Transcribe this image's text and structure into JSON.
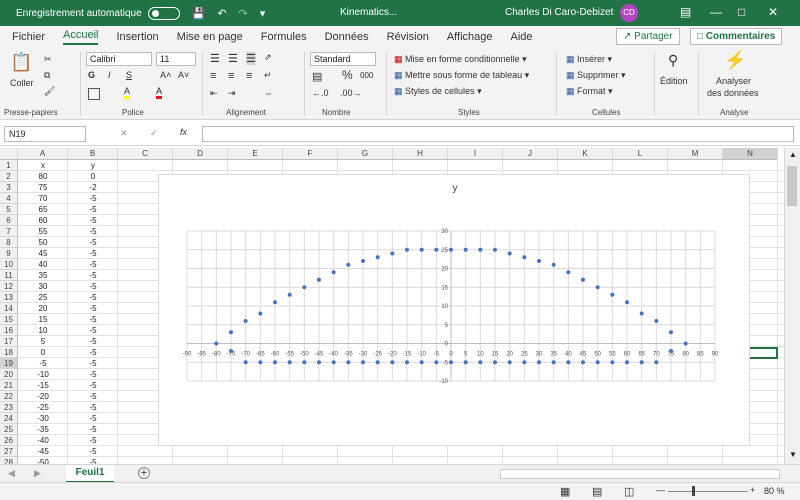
{
  "titlebar": {
    "autosave": "Enregistrement automatique",
    "title": "Kinematics...",
    "user": "Charles Di Caro-Debizet",
    "initials": "CD"
  },
  "tabs": [
    "Fichier",
    "Accueil",
    "Insertion",
    "Mise en page",
    "Formules",
    "Données",
    "Révision",
    "Affichage",
    "Aide"
  ],
  "share_label": "Partager",
  "comments_label": "Commentaires",
  "ribbon": {
    "paste": "Coller",
    "font_name": "Calibri",
    "font_size": "11",
    "number_format": "Standard",
    "cond_format": "Mise en forme conditionnelle",
    "table_format": "Mettre sous forme de tableau",
    "cell_styles": "Styles de cellules",
    "insert": "Insérer",
    "delete": "Supprimer",
    "format": "Format",
    "edit": "Édition",
    "analyze1": "Analyser",
    "analyze2": "des données",
    "groups": [
      "Presse-papiers",
      "Police",
      "Alignement",
      "Nombre",
      "Styles",
      "Cellules",
      "Analyse"
    ],
    "bold": "G",
    "italic": "I",
    "underline": "S",
    "percent": "%",
    "thousands": "000",
    "fill": "A",
    "fontcolor": "A"
  },
  "namebox": "N19",
  "fx": "fx",
  "columns": [
    "A",
    "B",
    "C",
    "D",
    "E",
    "F",
    "G",
    "H",
    "I",
    "J",
    "K",
    "L",
    "M",
    "N"
  ],
  "rows": [
    {
      "n": "1",
      "a": "x",
      "b": "y"
    },
    {
      "n": "2",
      "a": "80",
      "b": "0"
    },
    {
      "n": "3",
      "a": "75",
      "b": "-2"
    },
    {
      "n": "4",
      "a": "70",
      "b": "-5"
    },
    {
      "n": "5",
      "a": "65",
      "b": "-5"
    },
    {
      "n": "6",
      "a": "60",
      "b": "-5"
    },
    {
      "n": "7",
      "a": "55",
      "b": "-5"
    },
    {
      "n": "8",
      "a": "50",
      "b": "-5"
    },
    {
      "n": "9",
      "a": "45",
      "b": "-5"
    },
    {
      "n": "10",
      "a": "40",
      "b": "-5"
    },
    {
      "n": "11",
      "a": "35",
      "b": "-5"
    },
    {
      "n": "12",
      "a": "30",
      "b": "-5"
    },
    {
      "n": "13",
      "a": "25",
      "b": "-5"
    },
    {
      "n": "14",
      "a": "20",
      "b": "-5"
    },
    {
      "n": "15",
      "a": "15",
      "b": "-5"
    },
    {
      "n": "16",
      "a": "10",
      "b": "-5"
    },
    {
      "n": "17",
      "a": "5",
      "b": "-5"
    },
    {
      "n": "18",
      "a": "0",
      "b": "-5"
    },
    {
      "n": "19",
      "a": "-5",
      "b": "-5"
    },
    {
      "n": "20",
      "a": "-10",
      "b": "-5"
    },
    {
      "n": "21",
      "a": "-15",
      "b": "-5"
    },
    {
      "n": "22",
      "a": "-20",
      "b": "-5"
    },
    {
      "n": "23",
      "a": "-25",
      "b": "-5"
    },
    {
      "n": "24",
      "a": "-30",
      "b": "-5"
    },
    {
      "n": "25",
      "a": "-35",
      "b": "-5"
    },
    {
      "n": "26",
      "a": "-40",
      "b": "-5"
    },
    {
      "n": "27",
      "a": "-45",
      "b": "-5"
    },
    {
      "n": "28",
      "a": "-50",
      "b": "-5"
    }
  ],
  "sheet_tab": "Feuil1",
  "zoom": "80 %",
  "colors": {
    "accent": "#217346",
    "marker": "#4472c4"
  },
  "chart_data": {
    "type": "scatter",
    "title": "y",
    "xlim": [
      -90,
      90
    ],
    "ylim": [
      -10,
      30
    ],
    "xticks": [
      -90,
      -85,
      -80,
      -75,
      -70,
      -65,
      -60,
      -55,
      -50,
      -45,
      -40,
      -35,
      -30,
      -25,
      -20,
      -15,
      -10,
      -5,
      0,
      5,
      10,
      15,
      20,
      25,
      30,
      35,
      40,
      45,
      50,
      55,
      60,
      65,
      70,
      75,
      80,
      85,
      90
    ],
    "yticks": [
      -10,
      -5,
      0,
      5,
      10,
      15,
      20,
      25,
      30
    ],
    "grid": true,
    "points": [
      {
        "x": -80,
        "y": 0
      },
      {
        "x": -75,
        "y": 3
      },
      {
        "x": -70,
        "y": 6
      },
      {
        "x": -65,
        "y": 8
      },
      {
        "x": -60,
        "y": 11
      },
      {
        "x": -55,
        "y": 13
      },
      {
        "x": -50,
        "y": 15
      },
      {
        "x": -45,
        "y": 17
      },
      {
        "x": -40,
        "y": 19
      },
      {
        "x": -35,
        "y": 21
      },
      {
        "x": -30,
        "y": 22
      },
      {
        "x": -25,
        "y": 23
      },
      {
        "x": -20,
        "y": 24
      },
      {
        "x": -15,
        "y": 25
      },
      {
        "x": -10,
        "y": 25
      },
      {
        "x": -5,
        "y": 25
      },
      {
        "x": 0,
        "y": 25
      },
      {
        "x": 5,
        "y": 25
      },
      {
        "x": 10,
        "y": 25
      },
      {
        "x": 15,
        "y": 25
      },
      {
        "x": 20,
        "y": 24
      },
      {
        "x": 25,
        "y": 23
      },
      {
        "x": 30,
        "y": 22
      },
      {
        "x": 35,
        "y": 21
      },
      {
        "x": 40,
        "y": 19
      },
      {
        "x": 45,
        "y": 17
      },
      {
        "x": 50,
        "y": 15
      },
      {
        "x": 55,
        "y": 13
      },
      {
        "x": 60,
        "y": 11
      },
      {
        "x": 65,
        "y": 8
      },
      {
        "x": 70,
        "y": 6
      },
      {
        "x": 75,
        "y": 3
      },
      {
        "x": 80,
        "y": 0
      },
      {
        "x": 75,
        "y": -2
      },
      {
        "x": -75,
        "y": -2
      },
      {
        "x": 70,
        "y": -5
      },
      {
        "x": 65,
        "y": -5
      },
      {
        "x": 60,
        "y": -5
      },
      {
        "x": 55,
        "y": -5
      },
      {
        "x": 50,
        "y": -5
      },
      {
        "x": 45,
        "y": -5
      },
      {
        "x": 40,
        "y": -5
      },
      {
        "x": 35,
        "y": -5
      },
      {
        "x": 30,
        "y": -5
      },
      {
        "x": 25,
        "y": -5
      },
      {
        "x": 20,
        "y": -5
      },
      {
        "x": 15,
        "y": -5
      },
      {
        "x": 10,
        "y": -5
      },
      {
        "x": 5,
        "y": -5
      },
      {
        "x": 0,
        "y": -5
      },
      {
        "x": -5,
        "y": -5
      },
      {
        "x": -10,
        "y": -5
      },
      {
        "x": -15,
        "y": -5
      },
      {
        "x": -20,
        "y": -5
      },
      {
        "x": -25,
        "y": -5
      },
      {
        "x": -30,
        "y": -5
      },
      {
        "x": -35,
        "y": -5
      },
      {
        "x": -40,
        "y": -5
      },
      {
        "x": -45,
        "y": -5
      },
      {
        "x": -50,
        "y": -5
      },
      {
        "x": -55,
        "y": -5
      },
      {
        "x": -60,
        "y": -5
      },
      {
        "x": -65,
        "y": -5
      },
      {
        "x": -70,
        "y": -5
      }
    ]
  }
}
